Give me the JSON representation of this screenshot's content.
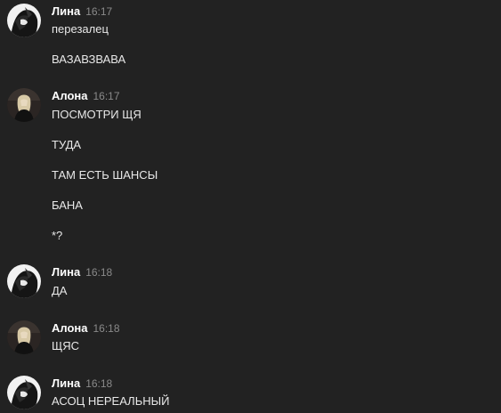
{
  "messages": [
    {
      "author": "Лина",
      "time": "16:17",
      "avatar_icon": "lina-avatar",
      "lines": [
        "перезалец",
        "ВАЗАВЗВАВА"
      ]
    },
    {
      "author": "Алона",
      "time": "16:17",
      "avatar_icon": "alona-avatar",
      "lines": [
        "ПОСМОТРИ ЩЯ",
        "ТУДА",
        "ТАМ ЕСТЬ ШАНСЫ",
        "БАНА",
        "*?"
      ]
    },
    {
      "author": "Лина",
      "time": "16:18",
      "avatar_icon": "lina-avatar",
      "lines": [
        "ДА"
      ]
    },
    {
      "author": "Алона",
      "time": "16:18",
      "avatar_icon": "alona-avatar",
      "lines": [
        "ЩЯС"
      ]
    },
    {
      "author": "Лина",
      "time": "16:18",
      "avatar_icon": "lina-avatar",
      "lines": [
        "АСОЦ НЕРЕАЛЬНЫЙ"
      ]
    }
  ],
  "colors": {
    "background": "#222222",
    "username": "#ffffff",
    "timestamp": "#8a8a8a",
    "text": "#e8e8e8"
  }
}
